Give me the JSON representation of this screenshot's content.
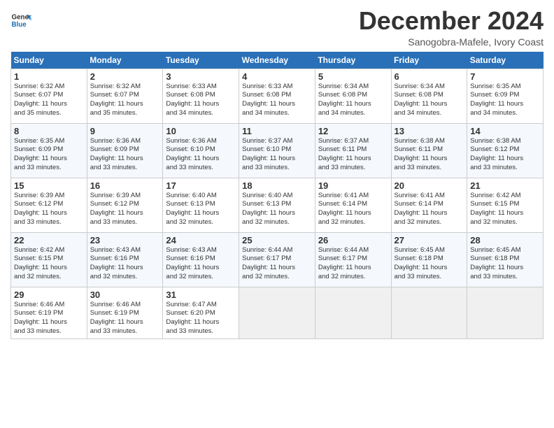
{
  "logo": {
    "line1": "General",
    "line2": "Blue"
  },
  "title": "December 2024",
  "subtitle": "Sanogobra-Mafele, Ivory Coast",
  "headers": [
    "Sunday",
    "Monday",
    "Tuesday",
    "Wednesday",
    "Thursday",
    "Friday",
    "Saturday"
  ],
  "weeks": [
    [
      {
        "day": "1",
        "info": "Sunrise: 6:32 AM\nSunset: 6:07 PM\nDaylight: 11 hours\nand 35 minutes."
      },
      {
        "day": "2",
        "info": "Sunrise: 6:32 AM\nSunset: 6:07 PM\nDaylight: 11 hours\nand 35 minutes."
      },
      {
        "day": "3",
        "info": "Sunrise: 6:33 AM\nSunset: 6:08 PM\nDaylight: 11 hours\nand 34 minutes."
      },
      {
        "day": "4",
        "info": "Sunrise: 6:33 AM\nSunset: 6:08 PM\nDaylight: 11 hours\nand 34 minutes."
      },
      {
        "day": "5",
        "info": "Sunrise: 6:34 AM\nSunset: 6:08 PM\nDaylight: 11 hours\nand 34 minutes."
      },
      {
        "day": "6",
        "info": "Sunrise: 6:34 AM\nSunset: 6:08 PM\nDaylight: 11 hours\nand 34 minutes."
      },
      {
        "day": "7",
        "info": "Sunrise: 6:35 AM\nSunset: 6:09 PM\nDaylight: 11 hours\nand 34 minutes."
      }
    ],
    [
      {
        "day": "8",
        "info": "Sunrise: 6:35 AM\nSunset: 6:09 PM\nDaylight: 11 hours\nand 33 minutes."
      },
      {
        "day": "9",
        "info": "Sunrise: 6:36 AM\nSunset: 6:09 PM\nDaylight: 11 hours\nand 33 minutes."
      },
      {
        "day": "10",
        "info": "Sunrise: 6:36 AM\nSunset: 6:10 PM\nDaylight: 11 hours\nand 33 minutes."
      },
      {
        "day": "11",
        "info": "Sunrise: 6:37 AM\nSunset: 6:10 PM\nDaylight: 11 hours\nand 33 minutes."
      },
      {
        "day": "12",
        "info": "Sunrise: 6:37 AM\nSunset: 6:11 PM\nDaylight: 11 hours\nand 33 minutes."
      },
      {
        "day": "13",
        "info": "Sunrise: 6:38 AM\nSunset: 6:11 PM\nDaylight: 11 hours\nand 33 minutes."
      },
      {
        "day": "14",
        "info": "Sunrise: 6:38 AM\nSunset: 6:12 PM\nDaylight: 11 hours\nand 33 minutes."
      }
    ],
    [
      {
        "day": "15",
        "info": "Sunrise: 6:39 AM\nSunset: 6:12 PM\nDaylight: 11 hours\nand 33 minutes."
      },
      {
        "day": "16",
        "info": "Sunrise: 6:39 AM\nSunset: 6:12 PM\nDaylight: 11 hours\nand 33 minutes."
      },
      {
        "day": "17",
        "info": "Sunrise: 6:40 AM\nSunset: 6:13 PM\nDaylight: 11 hours\nand 32 minutes."
      },
      {
        "day": "18",
        "info": "Sunrise: 6:40 AM\nSunset: 6:13 PM\nDaylight: 11 hours\nand 32 minutes."
      },
      {
        "day": "19",
        "info": "Sunrise: 6:41 AM\nSunset: 6:14 PM\nDaylight: 11 hours\nand 32 minutes."
      },
      {
        "day": "20",
        "info": "Sunrise: 6:41 AM\nSunset: 6:14 PM\nDaylight: 11 hours\nand 32 minutes."
      },
      {
        "day": "21",
        "info": "Sunrise: 6:42 AM\nSunset: 6:15 PM\nDaylight: 11 hours\nand 32 minutes."
      }
    ],
    [
      {
        "day": "22",
        "info": "Sunrise: 6:42 AM\nSunset: 6:15 PM\nDaylight: 11 hours\nand 32 minutes."
      },
      {
        "day": "23",
        "info": "Sunrise: 6:43 AM\nSunset: 6:16 PM\nDaylight: 11 hours\nand 32 minutes."
      },
      {
        "day": "24",
        "info": "Sunrise: 6:43 AM\nSunset: 6:16 PM\nDaylight: 11 hours\nand 32 minutes."
      },
      {
        "day": "25",
        "info": "Sunrise: 6:44 AM\nSunset: 6:17 PM\nDaylight: 11 hours\nand 32 minutes."
      },
      {
        "day": "26",
        "info": "Sunrise: 6:44 AM\nSunset: 6:17 PM\nDaylight: 11 hours\nand 32 minutes."
      },
      {
        "day": "27",
        "info": "Sunrise: 6:45 AM\nSunset: 6:18 PM\nDaylight: 11 hours\nand 33 minutes."
      },
      {
        "day": "28",
        "info": "Sunrise: 6:45 AM\nSunset: 6:18 PM\nDaylight: 11 hours\nand 33 minutes."
      }
    ],
    [
      {
        "day": "29",
        "info": "Sunrise: 6:46 AM\nSunset: 6:19 PM\nDaylight: 11 hours\nand 33 minutes."
      },
      {
        "day": "30",
        "info": "Sunrise: 6:46 AM\nSunset: 6:19 PM\nDaylight: 11 hours\nand 33 minutes."
      },
      {
        "day": "31",
        "info": "Sunrise: 6:47 AM\nSunset: 6:20 PM\nDaylight: 11 hours\nand 33 minutes."
      },
      {
        "day": "",
        "info": ""
      },
      {
        "day": "",
        "info": ""
      },
      {
        "day": "",
        "info": ""
      },
      {
        "day": "",
        "info": ""
      }
    ]
  ]
}
